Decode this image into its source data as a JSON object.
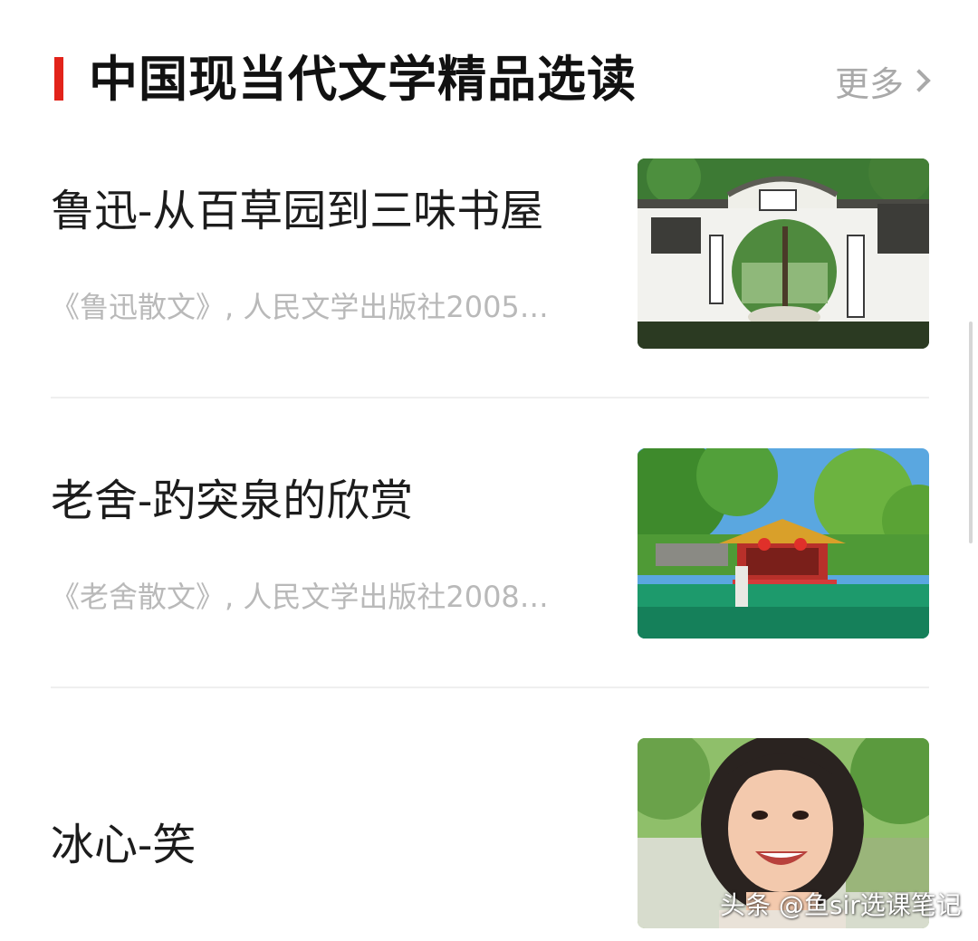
{
  "section": {
    "title": "中国现当代文学精品选读",
    "more_label": "更多",
    "accent_color": "#e2231a"
  },
  "articles": [
    {
      "title": "鲁迅-从百草园到三味书屋",
      "source": "《鲁迅散文》, 人民文学出版社2005…",
      "thumbnail": "round-moon-gate-photo"
    },
    {
      "title": "老舍-趵突泉的欣赏",
      "source": "《老舍散文》, 人民文学出版社2008…",
      "thumbnail": "pavilion-spring-photo"
    },
    {
      "title": "冰心-笑",
      "source": "",
      "thumbnail": "smiling-girl-photo"
    }
  ],
  "watermark": "头条 @鱼sir选课笔记"
}
